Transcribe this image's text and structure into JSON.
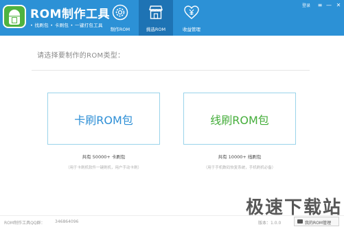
{
  "header": {
    "app_title": "ROM制作工具",
    "app_subtitle": "• 找刷包 • 卡刷包 • 一键打包工具",
    "tabs": [
      {
        "label": "制作ROM",
        "icon": "gear-icon",
        "active": false
      },
      {
        "label": "挑选ROM",
        "icon": "store-icon",
        "active": true
      },
      {
        "label": "收益管理",
        "icon": "heart-yen-icon",
        "active": false
      }
    ],
    "user_link": "登录",
    "window_controls": {
      "menu": "≡",
      "minimize": "—",
      "close": "✕"
    }
  },
  "main": {
    "prompt": "请选择要制作的ROM类型：",
    "options": [
      {
        "label": "卡刷ROM包",
        "count": "共有 50000+ 卡刷包",
        "hint": "（用于卡刷机软件一键刷机，用户手动卡刷）"
      },
      {
        "label": "线刷ROM包",
        "count": "共有 10000+ 线刷包",
        "hint": "（用于手机数码恢复系统，手机刷机必备）"
      }
    ]
  },
  "footer": {
    "qq_label": "ROM制作工具QQ群：",
    "qq_number": "346864096",
    "version": "版本：1.0.0",
    "my_rom_button": "我的ROM管理"
  },
  "watermark": {
    "text": "极速下载站"
  },
  "colors": {
    "header_bg": "#2c91d6",
    "active_tab": "#1e73b4",
    "card_blue": "#2e8fd6",
    "card_green": "#44ad3a"
  }
}
